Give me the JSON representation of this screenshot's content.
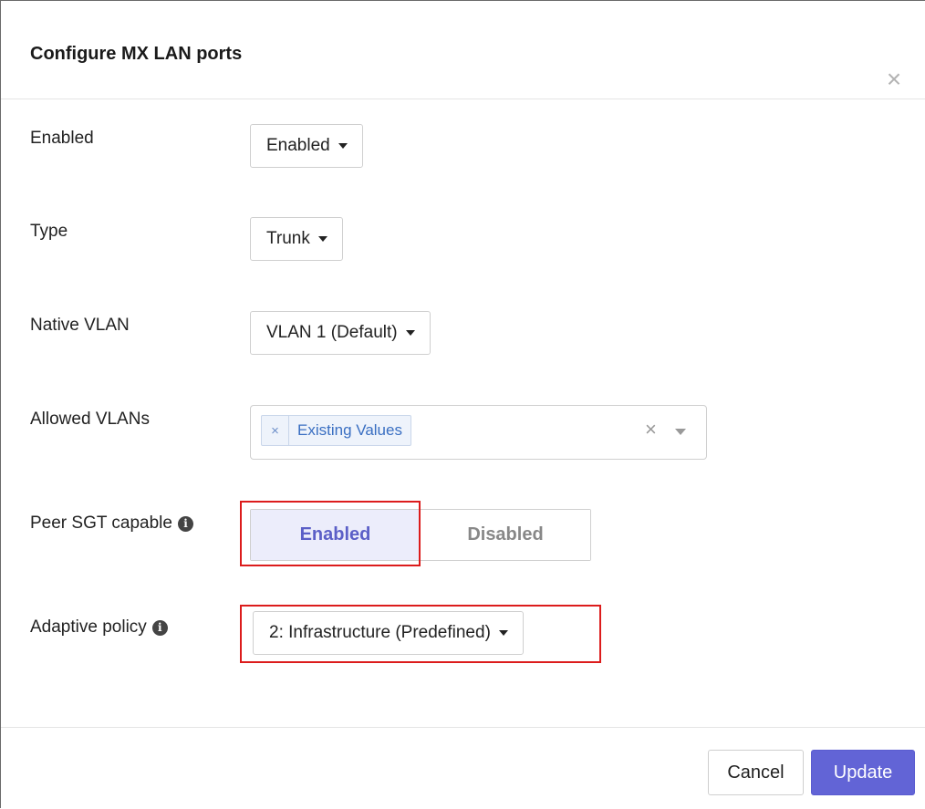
{
  "dialog": {
    "title": "Configure MX LAN ports",
    "close_label": "×"
  },
  "fields": {
    "enabled": {
      "label": "Enabled",
      "value": "Enabled"
    },
    "type": {
      "label": "Type",
      "value": "Trunk"
    },
    "native_vlan": {
      "label": "Native VLAN",
      "value": "VLAN 1 (Default)"
    },
    "allowed_vlans": {
      "label": "Allowed VLANs",
      "chips": [
        "Existing Values"
      ],
      "chip_remove": "×",
      "clear": "×"
    },
    "peer_sgt": {
      "label": "Peer SGT capable",
      "options": [
        "Enabled",
        "Disabled"
      ],
      "selected": "Enabled"
    },
    "adaptive_policy": {
      "label": "Adaptive policy",
      "value": "2: Infrastructure (Predefined)"
    }
  },
  "info_icon": "i",
  "footer": {
    "cancel_label": "Cancel",
    "update_label": "Update"
  },
  "colors": {
    "accent": "#6264d6",
    "selected_toggle_bg": "#ecedfb",
    "highlight_box": "#dc1c1c",
    "chip_text": "#3a6fc2"
  },
  "icons": [
    "close-icon",
    "caret-down-icon",
    "info-icon",
    "chip-remove-icon",
    "clear-icon"
  ]
}
